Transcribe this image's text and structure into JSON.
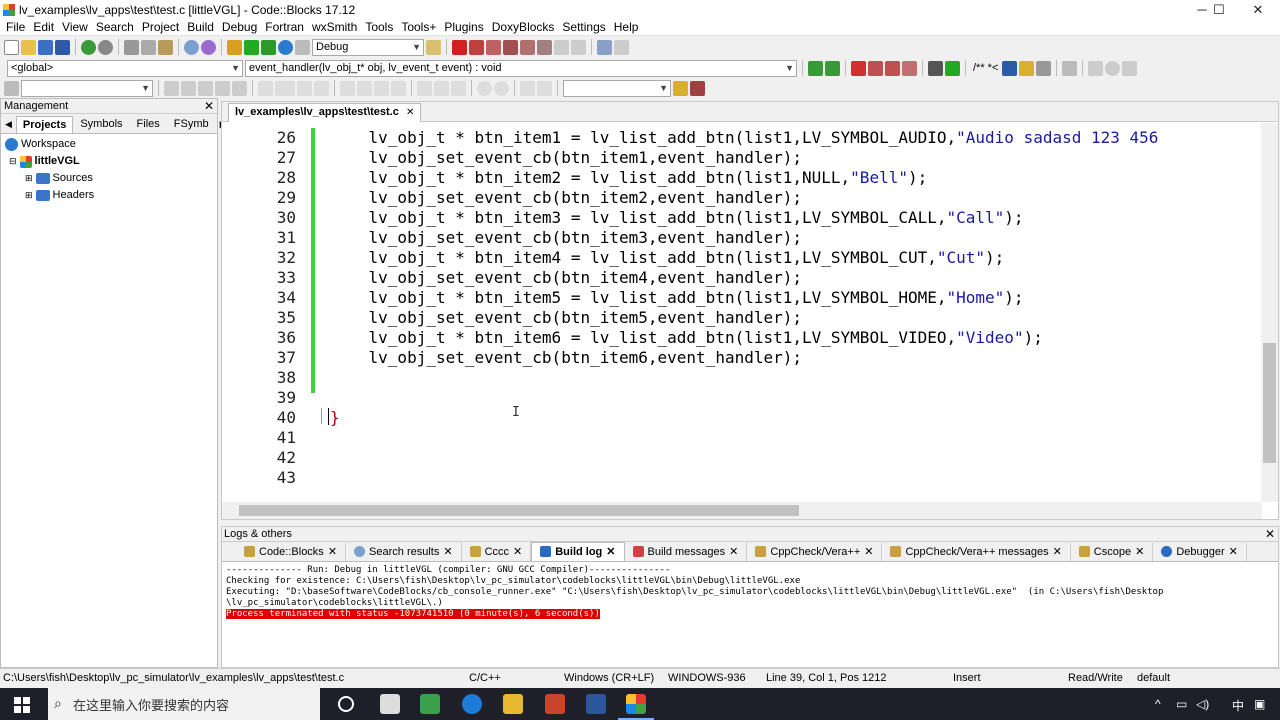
{
  "window": {
    "title": "lv_examples\\lv_apps\\test\\test.c [littleVGL] - Code::Blocks 17.12",
    "min": "─",
    "max": "☐",
    "close": "✕"
  },
  "menu": [
    "File",
    "Edit",
    "View",
    "Search",
    "Project",
    "Build",
    "Debug",
    "Fortran",
    "wxSmith",
    "Tools",
    "Tools+",
    "Plugins",
    "DoxyBlocks",
    "Settings",
    "Help"
  ],
  "toolbar": {
    "build_target": "Debug",
    "scope": "<global>",
    "function": "event_handler(lv_obj_t* obj, lv_event_t event) : void",
    "comment_btn": "/** *<"
  },
  "management": {
    "title": "Management",
    "tabs": [
      "Projects",
      "Symbols",
      "Files",
      "FSymb"
    ],
    "tree": {
      "workspace": "Workspace",
      "project": "littleVGL",
      "sources": "Sources",
      "headers": "Headers"
    }
  },
  "editor": {
    "tab": "lv_examples\\lv_apps\\test\\test.c",
    "lines": [
      {
        "n": "26",
        "code": "    lv_obj_t * btn_item1 = lv_list_add_btn(list1,LV_SYMBOL_AUDIO,\"Audio sadasd 123 456"
      },
      {
        "n": "27",
        "code": "    lv_obj_set_event_cb(btn_item1,event_handler);"
      },
      {
        "n": "28",
        "code": "    lv_obj_t * btn_item2 = lv_list_add_btn(list1,NULL,\"Bell\");"
      },
      {
        "n": "29",
        "code": "    lv_obj_set_event_cb(btn_item2,event_handler);"
      },
      {
        "n": "30",
        "code": "    lv_obj_t * btn_item3 = lv_list_add_btn(list1,LV_SYMBOL_CALL,\"Call\");"
      },
      {
        "n": "31",
        "code": "    lv_obj_set_event_cb(btn_item3,event_handler);"
      },
      {
        "n": "32",
        "code": "    lv_obj_t * btn_item4 = lv_list_add_btn(list1,LV_SYMBOL_CUT,\"Cut\");"
      },
      {
        "n": "33",
        "code": "    lv_obj_set_event_cb(btn_item4,event_handler);"
      },
      {
        "n": "34",
        "code": "    lv_obj_t * btn_item5 = lv_list_add_btn(list1,LV_SYMBOL_HOME,\"Home\");"
      },
      {
        "n": "35",
        "code": "    lv_obj_set_event_cb(btn_item5,event_handler);"
      },
      {
        "n": "36",
        "code": "    lv_obj_t * btn_item6 = lv_list_add_btn(list1,LV_SYMBOL_VIDEO,\"Video\");"
      },
      {
        "n": "37",
        "code": "    lv_obj_set_event_cb(btn_item6,event_handler);"
      },
      {
        "n": "38",
        "code": ""
      },
      {
        "n": "39",
        "code": ""
      },
      {
        "n": "40",
        "code": "}"
      },
      {
        "n": "41",
        "code": ""
      },
      {
        "n": "42",
        "code": ""
      },
      {
        "n": "43",
        "code": ""
      }
    ]
  },
  "logs": {
    "title": "Logs & others",
    "tabs": [
      "Code::Blocks",
      "Search results",
      "Cccc",
      "Build log",
      "Build messages",
      "CppCheck/Vera++",
      "CppCheck/Vera++ messages",
      "Cscope",
      "Debugger"
    ],
    "active_tab": "Build log",
    "lines": [
      "-------------- Run: Debug in littleVGL (compiler: GNU GCC Compiler)---------------",
      "",
      "Checking for existence: C:\\Users\\fish\\Desktop\\lv_pc_simulator\\codeblocks\\littleVGL\\bin\\Debug\\littleVGL.exe",
      "Executing: \"D:\\baseSoftware\\CodeBlocks/cb_console_runner.exe\" \"C:\\Users\\fish\\Desktop\\lv_pc_simulator\\codeblocks\\littleVGL\\bin\\Debug\\littleVGL.exe\"  (in C:\\Users\\fish\\Desktop",
      "\\lv_pc_simulator\\codeblocks\\littleVGL\\.)"
    ],
    "error_line": "Process terminated with status -1073741510 (0 minute(s), 6 second(s))"
  },
  "status": {
    "path": "C:\\Users\\fish\\Desktop\\lv_pc_simulator\\lv_examples\\lv_apps\\test\\test.c",
    "lang": "C/C++",
    "eol": "Windows (CR+LF)",
    "encoding": "WINDOWS-936",
    "position": "Line 39, Col 1, Pos 1212",
    "mode": "Insert",
    "access": "Read/Write",
    "profile": "default"
  },
  "taskbar": {
    "search_placeholder": "在这里输入你要搜索的内容",
    "ime": "中",
    "tray_up": "^"
  },
  "colors": {
    "accent": "#1e5fd0",
    "error_bg": "#e00000",
    "changebar": "#40d040"
  }
}
